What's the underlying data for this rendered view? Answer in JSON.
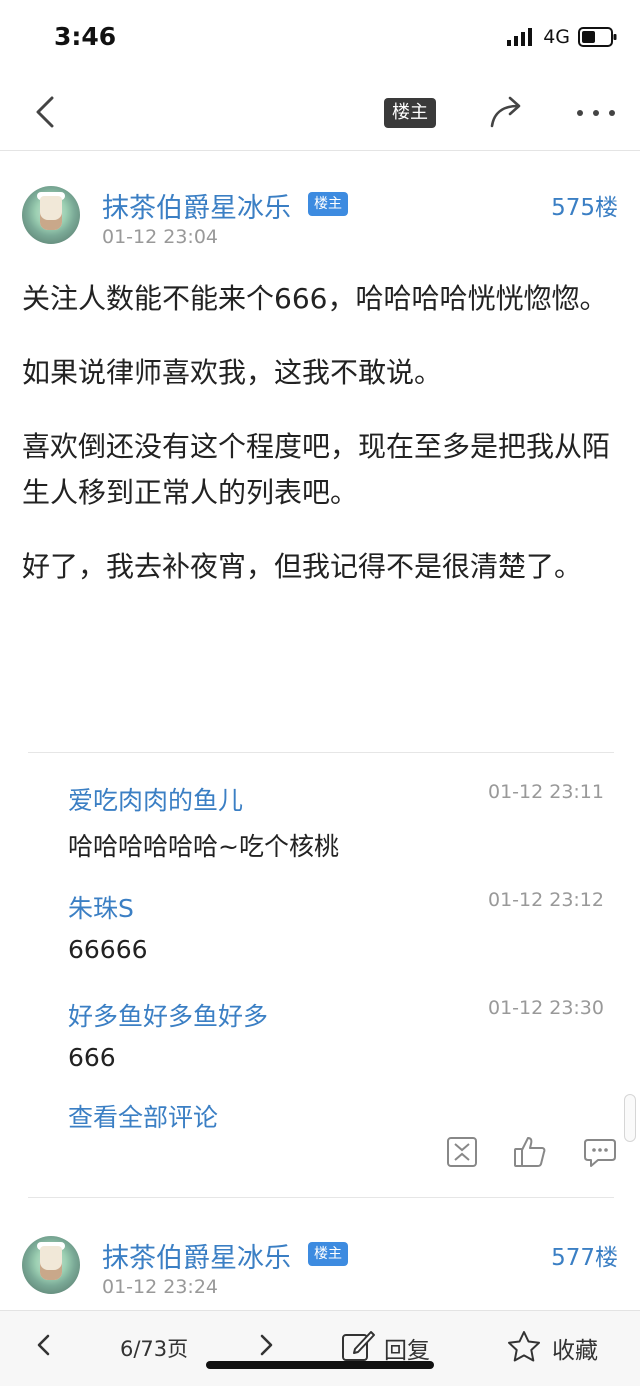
{
  "status_bar": {
    "time": "3:46",
    "network": "4G"
  },
  "nav": {
    "louzhu_label": "楼主"
  },
  "post": {
    "author": "抹茶伯爵星冰乐",
    "badge": "楼主",
    "time": "01-12 23:04",
    "floor": "575楼",
    "paragraphs": [
      "关注人数能不能来个666，哈哈哈哈恍恍惚惚。",
      "如果说律师喜欢我，这我不敢说。",
      "喜欢倒还没有这个程度吧，现在至多是把我从陌生人移到正常人的列表吧。",
      "好了，我去补夜宵，但我记得不是很清楚了。"
    ]
  },
  "comments": [
    {
      "name": "爱吃肉肉的鱼儿",
      "time": "01-12 23:11",
      "text": "哈哈哈哈哈哈~吃个核桃"
    },
    {
      "name": "朱珠S",
      "time": "01-12 23:12",
      "text": "66666"
    },
    {
      "name": "好多鱼好多鱼好多",
      "time": "01-12 23:30",
      "text": "666"
    }
  ],
  "view_all": "查看全部评论",
  "next_post": {
    "author": "抹茶伯爵星冰乐",
    "badge": "楼主",
    "time": "01-12 23:24",
    "floor": "577楼"
  },
  "bottom_bar": {
    "page": "6/73页",
    "reply": "回复",
    "favorite": "收藏"
  },
  "icons": [
    "back-icon",
    "share-icon",
    "more-icon",
    "report-icon",
    "thumbs-up-icon",
    "comment-icon",
    "prev-page-icon",
    "next-page-icon",
    "edit-icon",
    "star-icon"
  ]
}
